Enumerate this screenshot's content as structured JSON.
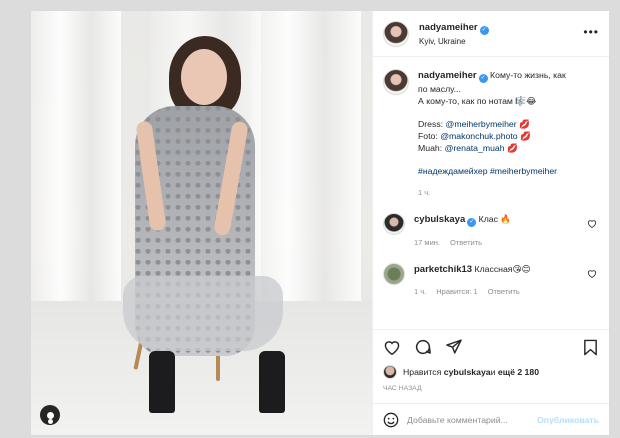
{
  "post": {
    "author": "nadyameiher",
    "location": "Kyiv, Ukraine",
    "verified_mark": "✓",
    "caption": {
      "line1": "Кому-то жизнь, как",
      "line2": "по маслу...",
      "line3": "А кому-то, как по нотам 🎼😂",
      "dress": "Dress: ",
      "dress_link": "@meiherbymeiher",
      "foto": "Foto: ",
      "foto_link": "@makonchuk.photo",
      "foto_emoji": "💋",
      "muah": "Muah: ",
      "muah_link": "@renata_muah",
      "muah_emoji": "💋",
      "dress_emoji": "💋",
      "tags": "#надеждамейхер #meiherbymeiher",
      "time": "1 ч."
    }
  },
  "comments": [
    {
      "user": "cybulskaya",
      "text": "Клас 🔥",
      "time": "17 мин.",
      "reply": "Ответить"
    },
    {
      "user": "parketchik13",
      "text": "Классная😘😊",
      "time": "1 ч.",
      "likes": "Нравится: 1",
      "reply": "Ответить"
    }
  ],
  "likes": {
    "prefix": "Нравится ",
    "user": "cybulskaya",
    "suffix": " и ",
    "others": "ещё 2 180"
  },
  "time_ago": "Час назад",
  "add_comment": {
    "placeholder": "Добавьте комментарий...",
    "publish": "Опубликовать"
  },
  "icons": {
    "more": "more-horizontal-icon",
    "heart": "heart-icon",
    "comment": "comment-icon",
    "share": "paper-plane-icon",
    "bookmark": "bookmark-icon",
    "emoji": "smiley-icon",
    "user_tags": "person-tag-icon"
  },
  "colors": {
    "verified": "#3897f0",
    "link": "#00376b",
    "muted": "#8e8e8e",
    "publish_disabled": "#b2dffc"
  }
}
